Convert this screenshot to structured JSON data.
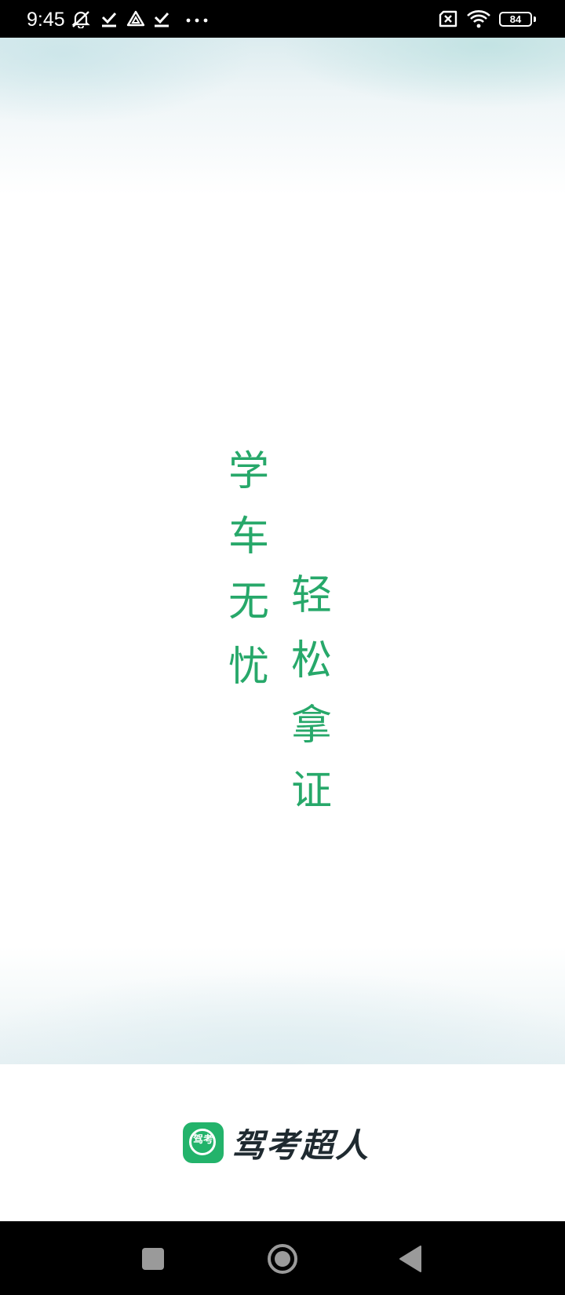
{
  "status_bar": {
    "time": "9:45",
    "battery_level": "84",
    "icons": [
      "mute-icon",
      "check-icon",
      "drive-icon",
      "check-icon",
      "more-dots-icon",
      "no-sim-icon",
      "wifi-icon",
      "battery-icon"
    ]
  },
  "splash": {
    "slogan_left": [
      "学",
      "车",
      "无",
      "忧"
    ],
    "slogan_right": [
      "轻",
      "松",
      "拿",
      "证"
    ],
    "accent_color": "#27a86a"
  },
  "brand": {
    "logo_text": "驾考",
    "name": "驾考超人",
    "logo_color": "#23b36b"
  },
  "nav_bar": {
    "buttons": [
      "recents-square-icon",
      "home-circle-icon",
      "back-triangle-icon"
    ]
  }
}
